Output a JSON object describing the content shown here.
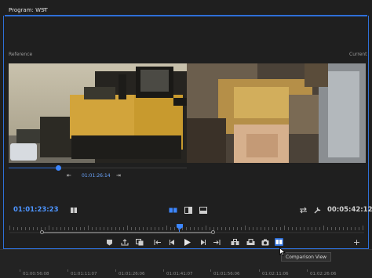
{
  "panel": {
    "title": "Program: WST",
    "menu_icon": "≡"
  },
  "views": {
    "reference_label": "Reference",
    "current_label": "Current"
  },
  "reference_scrubber": {
    "timecode": "01:01:26:14",
    "prev_icon": "⇤",
    "next_icon": "⇥",
    "position": 0.27
  },
  "program": {
    "current_timecode": "01:01:23:23",
    "duration": "00:05:42:12",
    "playhead_position": 0.48
  },
  "controls": {
    "add_marker": "♥",
    "mark_in": "{",
    "mark_out": "}",
    "go_in": "{←",
    "step_back": "◂|",
    "play": "▶",
    "step_forward": "|▸",
    "go_out": "→}",
    "insert": "▣",
    "overwrite": "▤",
    "lift": "⇪",
    "extract": "⇩",
    "export_frame": "◉",
    "comparison_view": "▦",
    "add": "+"
  },
  "tooltip": "Comparison View",
  "timeline": {
    "timecodes": [
      "01:00:56:08",
      "01:01:11:07",
      "01:01:26:06",
      "01:01:41:07",
      "01:01:56:06",
      "01:02:11:06",
      "01:02:26:06"
    ]
  },
  "colors": {
    "accent": "#2e6fd8",
    "timecode_blue": "#4d94ff"
  }
}
